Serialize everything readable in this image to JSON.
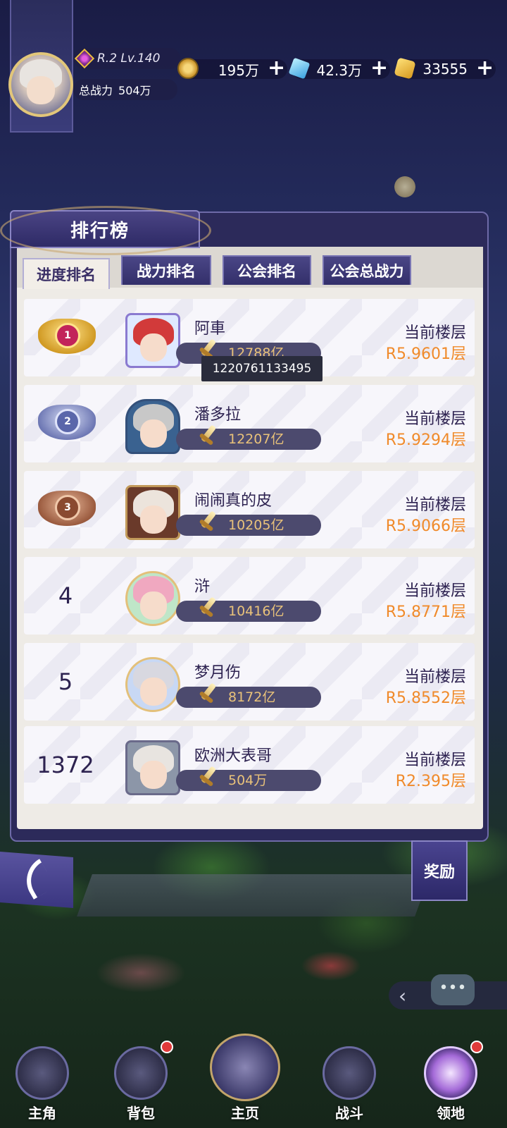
{
  "header": {
    "level": "R.2 Lv.140",
    "power_label": "总战力",
    "power_value": "504万",
    "resources": [
      {
        "icon": "coin-icon",
        "value": "195万"
      },
      {
        "icon": "crystal-icon",
        "value": "42.3万"
      },
      {
        "icon": "gold-bar-icon",
        "value": "33555"
      }
    ],
    "plus": "+"
  },
  "panel": {
    "title": "排行榜",
    "tabs": [
      {
        "label": "进度排名",
        "active": true
      },
      {
        "label": "战力排名",
        "active": false
      },
      {
        "label": "公会排名",
        "active": false
      },
      {
        "label": "公会总战力",
        "active": false
      }
    ],
    "floor_label": "当前楼层",
    "rows": [
      {
        "rank": "1",
        "medal": "gold",
        "name": "阿車",
        "power": "12788亿",
        "floor": "R5.9601层"
      },
      {
        "rank": "2",
        "medal": "silver",
        "name": "潘多拉",
        "power": "12207亿",
        "floor": "R5.9294层"
      },
      {
        "rank": "3",
        "medal": "bronze",
        "name": "闹闹真的皮",
        "power": "10205亿",
        "floor": "R5.9066层"
      },
      {
        "rank": "4",
        "medal": "",
        "name": "浒",
        "power": "10416亿",
        "floor": "R5.8771层"
      },
      {
        "rank": "5",
        "medal": "",
        "name": "梦月伤",
        "power": "8172亿",
        "floor": "R5.8552层"
      }
    ],
    "self": {
      "rank": "1372",
      "name": "欧洲大表哥",
      "power": "504万",
      "floor": "R2.395层"
    },
    "tooltip": "1220761133495"
  },
  "buttons": {
    "reward": "奖励",
    "chat_chevron": "‹"
  },
  "nav": [
    {
      "label": "主角",
      "badge": false
    },
    {
      "label": "背包",
      "badge": true
    },
    {
      "label": "主页",
      "badge": false
    },
    {
      "label": "战斗",
      "badge": false
    },
    {
      "label": "领地",
      "badge": true
    }
  ],
  "colors": {
    "floor_value": "#f08a2a",
    "power_value": "#e9c27a",
    "name_text": "#2d2250"
  }
}
